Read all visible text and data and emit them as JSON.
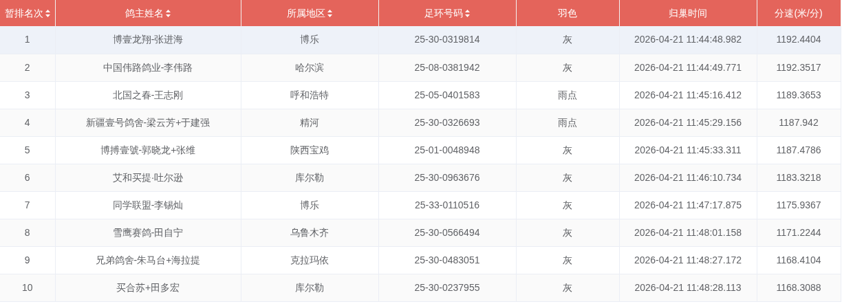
{
  "table": {
    "columns": [
      {
        "label": "暂排名次",
        "sortable": true
      },
      {
        "label": "鸽主姓名",
        "sortable": true
      },
      {
        "label": "所属地区",
        "sortable": true
      },
      {
        "label": "足环号码",
        "sortable": true
      },
      {
        "label": "羽色",
        "sortable": false
      },
      {
        "label": "归巢时间",
        "sortable": false
      },
      {
        "label": "分速(米/分)",
        "sortable": false
      }
    ],
    "rows": [
      {
        "highlighted": true,
        "cells": [
          "1",
          "博壹龙翔-张进海",
          "博乐",
          "25-30-0319814",
          "灰",
          "2026-04-21 11:44:48.982",
          "1192.4404"
        ]
      },
      {
        "highlighted": false,
        "cells": [
          "2",
          "中国伟路鸽业-李伟路",
          "哈尔滨",
          "25-08-0381942",
          "灰",
          "2026-04-21 11:44:49.771",
          "1192.3517"
        ]
      },
      {
        "highlighted": false,
        "cells": [
          "3",
          "北国之春-王志刚",
          "呼和浩特",
          "25-05-0401583",
          "雨点",
          "2026-04-21 11:45:16.412",
          "1189.3653"
        ]
      },
      {
        "highlighted": false,
        "cells": [
          "4",
          "新疆壹号鸽舍-梁云芳+于建强",
          "精河",
          "25-30-0326693",
          "雨点",
          "2026-04-21 11:45:29.156",
          "1187.942"
        ]
      },
      {
        "highlighted": false,
        "cells": [
          "5",
          "博搏壹號-郭晓龙+张维",
          "陕西宝鸡",
          "25-01-0048948",
          "灰",
          "2026-04-21 11:45:33.311",
          "1187.4786"
        ]
      },
      {
        "highlighted": false,
        "cells": [
          "6",
          "艾和买提·吐尔逊",
          "库尔勒",
          "25-30-0963676",
          "灰",
          "2026-04-21 11:46:10.734",
          "1183.3218"
        ]
      },
      {
        "highlighted": false,
        "cells": [
          "7",
          "同学联盟-李锡灿",
          "博乐",
          "25-33-0110516",
          "灰",
          "2026-04-21 11:47:17.875",
          "1175.9367"
        ]
      },
      {
        "highlighted": false,
        "cells": [
          "8",
          "雪鹰赛鸽-田自宁",
          "乌鲁木齐",
          "25-30-0566494",
          "灰",
          "2026-04-21 11:48:01.158",
          "1171.2244"
        ]
      },
      {
        "highlighted": false,
        "cells": [
          "9",
          "兄弟鸽舍-朱马台+海拉提",
          "克拉玛依",
          "25-30-0483051",
          "灰",
          "2026-04-21 11:48:27.172",
          "1168.4104"
        ]
      },
      {
        "highlighted": false,
        "cells": [
          "10",
          "买合苏+田多宏",
          "库尔勒",
          "25-30-0237955",
          "灰",
          "2026-04-21 11:48:28.113",
          "1168.3088"
        ]
      }
    ]
  }
}
